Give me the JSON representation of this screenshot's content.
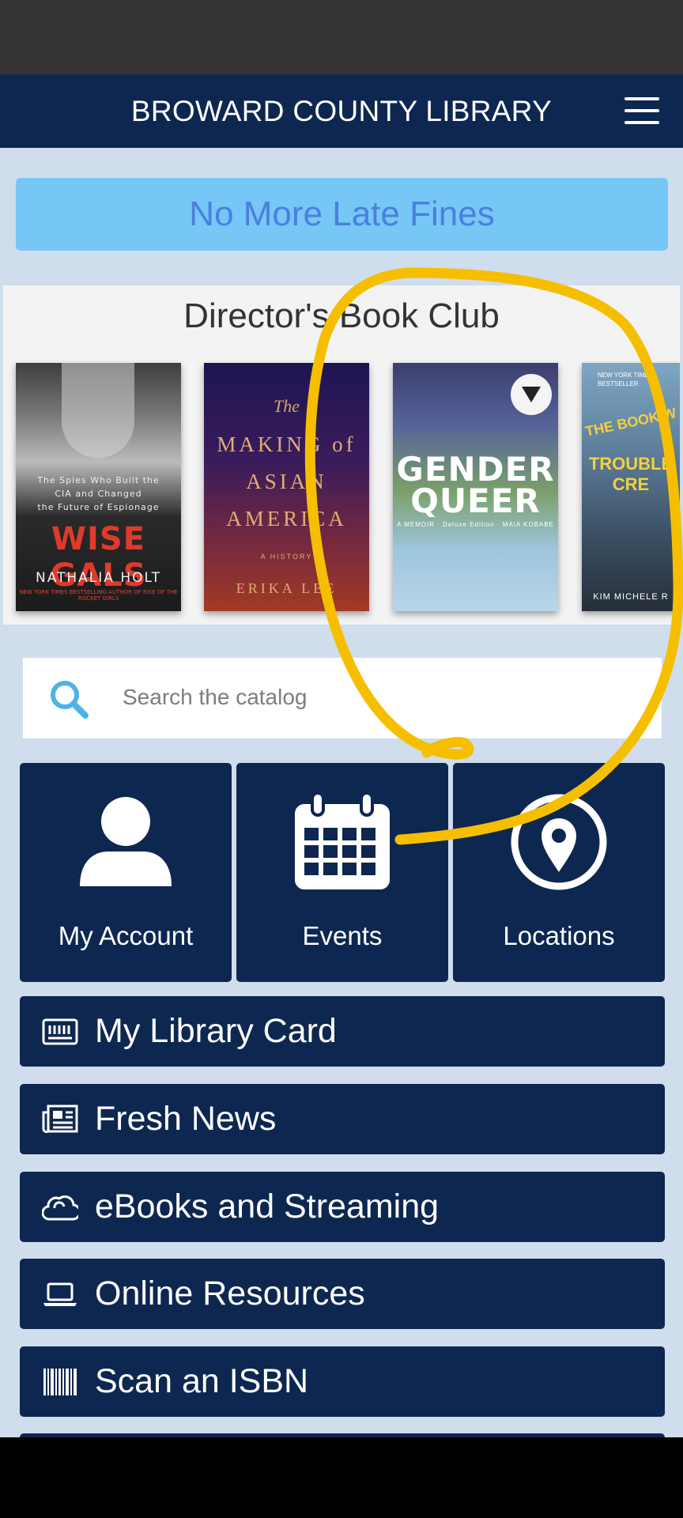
{
  "header": {
    "title": "BROWARD COUNTY LIBRARY",
    "menu_icon": "hamburger-menu-icon"
  },
  "banner": {
    "text": "No More Late Fines",
    "background": "#76c7f6",
    "text_color": "#4a7fe0"
  },
  "book_club": {
    "title": "Director's Book Club",
    "books": [
      {
        "lines": [
          "The Spies Who Built the",
          "CIA and Changed",
          "the Future of Espionage"
        ],
        "title": "WISE GALS",
        "author": "NATHALIA HOLT",
        "tagline": "NEW YORK TIMES BESTSELLING AUTHOR OF RISE OF THE ROCKET GIRLS"
      },
      {
        "the": "The",
        "title_lines": [
          "MAKING of",
          "ASIAN",
          "AMERICA"
        ],
        "kicker": "A HISTORY",
        "author": "ERIKA LEE"
      },
      {
        "title_lines": [
          "GENDER",
          "QUEER"
        ],
        "subtitle": "A MEMOIR · Deluxe Edition · MAIA KOBABE"
      },
      {
        "top": "NEW YORK TIMES BESTSELLER",
        "title_a": "THE BOOK W",
        "title_b": "TROUBLE CRE",
        "author": "KIM MICHELE R"
      }
    ]
  },
  "search": {
    "placeholder": "Search the catalog",
    "icon": "search-icon"
  },
  "tiles": [
    {
      "label": "My Account",
      "icon": "person-icon"
    },
    {
      "label": "Events",
      "icon": "calendar-icon"
    },
    {
      "label": "Locations",
      "icon": "location-pin-icon"
    }
  ],
  "menu_rows": [
    {
      "label": "My Library Card",
      "icon": "card-icon"
    },
    {
      "label": "Fresh News",
      "icon": "newspaper-icon"
    },
    {
      "label": "eBooks and Streaming",
      "icon": "cloud-icon"
    },
    {
      "label": "Online Resources",
      "icon": "laptop-icon"
    },
    {
      "label": "Scan an ISBN",
      "icon": "barcode-icon"
    }
  ],
  "colors": {
    "navy": "#0e2750",
    "page_background": "#cfdded",
    "annotation_highlight": "#f5bf00"
  }
}
